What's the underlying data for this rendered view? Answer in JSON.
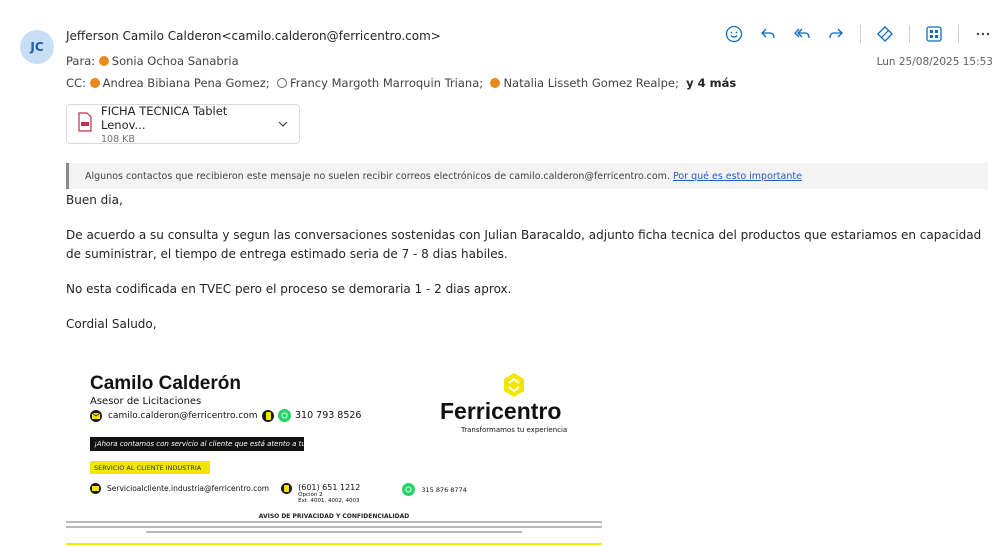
{
  "header": {
    "avatar_initials": "JC",
    "from": "Jefferson Camilo Calderon<camilo.calderon@ferricentro.com>",
    "to_label": "Para:",
    "to_name": "Sonia Ochoa Sanabria",
    "cc_label": "CC:",
    "cc": [
      "Andrea Bibiana Pena Gomez;",
      "Francy Margoth Marroquin Triana;",
      "Natalia Lisseth Gomez Realpe;"
    ],
    "cc_more": "y 4 más",
    "date": "Lun 25/08/2025 15:53"
  },
  "toolbar": {
    "icons": [
      "emoji-icon",
      "reply-icon",
      "reply-all-icon",
      "forward-icon",
      "sensitivity-icon",
      "apps-icon",
      "more-icon"
    ]
  },
  "attachment": {
    "name": "FICHA TECNICA Tablet Lenov...",
    "size": "108 KB"
  },
  "banner": {
    "text": "Algunos contactos que recibieron este mensaje no suelen recibir correos electrónicos de camilo.calderon@ferricentro.com.",
    "link": "Por qué es esto importante"
  },
  "body": {
    "greeting": "Buen dia,",
    "p1": "De acuerdo a su consulta y segun las conversaciones sostenidas con Julian Baracaldo, adjunto ficha tecnica del productos que estariamos en capacidad de suministrar, el tiempo de entrega estimado seria de 7 - 8 dias habiles.",
    "p2": "No esta codificada en TVEC pero el proceso se demoraria 1 - 2 dias aprox.",
    "closing": "Cordial Saludo,"
  },
  "signature": {
    "name": "Camilo Calderón",
    "role": "Asesor de Licitaciones",
    "email": "camilo.calderon@ferricentro.com",
    "phone": "310 793 8526",
    "black_band": "¡Ahora contamos con servicio al cliente que está atento a tu solicitud!",
    "yellow_band": "SERVICIO AL CLIENTE INDUSTRIA",
    "service_email": "Servicioalcliente.industria@ferricentro.com",
    "service_phone": "(601) 651 1212",
    "service_option": "Opción 2",
    "service_ext": "Ext. 4001, 4002, 4003",
    "service_mobile": "315 876 8774",
    "brand": "Ferricentro",
    "tagline": "Transformamos tu experiencia",
    "privacy_title": "AVISO DE PRIVACIDAD Y CONFIDENCIALIDAD"
  },
  "colors": {
    "accent": "#2b59c3",
    "presence": "#e8891a",
    "brand_yellow": "#f2e600"
  }
}
